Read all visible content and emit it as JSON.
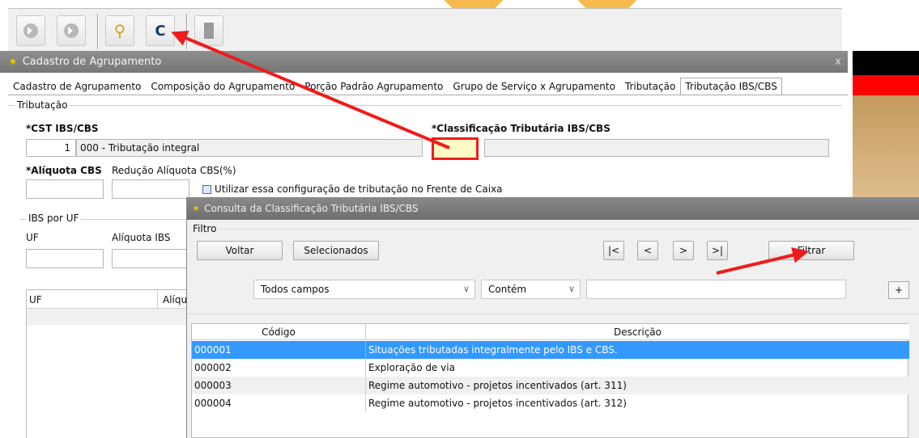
{
  "colors": {
    "accent_red": "#ee1c1c",
    "selection_blue": "#3399ff",
    "title_bar_grey": "#7f7f7f"
  },
  "toolbar": {
    "buttons": [
      {
        "name": "first-record-icon"
      },
      {
        "name": "next-record-icon"
      },
      {
        "name": "search-icon"
      },
      {
        "name": "consulta-c-icon",
        "label": "C"
      },
      {
        "name": "disabled-bar-icon"
      }
    ]
  },
  "main_window": {
    "title": "Cadastro de Agrupamento",
    "close": "x",
    "tabs": [
      {
        "label": "Cadastro de Agrupamento"
      },
      {
        "label": "Composição do Agrupamento"
      },
      {
        "label": "Porção Padrão Agrupamento"
      },
      {
        "label": "Grupo de Serviço x Agrupamento"
      },
      {
        "label": "Tributação"
      },
      {
        "label": "Tributação IBS/CBS"
      }
    ],
    "group_title": "Tributação",
    "cst_label": "*CST IBS/CBS",
    "cst_code": "1",
    "cst_desc": "000 - Tributação integral",
    "class_label": "*Classificação Tributária IBS/CBS",
    "aliq_cbs_label": "*Alíquota CBS",
    "red_aliq_label": "Redução Alíquota CBS(%)",
    "checkbox_label": "Utilizar essa configuração de tributação no Frente de Caixa",
    "ibs_uf_group": "IBS por UF",
    "uf_label": "UF",
    "aliq_ibs_label": "Alíquota IBS",
    "grid_col_uf": "UF",
    "grid_col_aliq": "Alíquo"
  },
  "dialog": {
    "title": "Consulta da Classificação Tributária IBS/CBS",
    "filter_group": "Filtro",
    "btn_voltar": "Voltar",
    "btn_selecionados": "Selecionados",
    "nav_first": "|<",
    "nav_prev": "<",
    "nav_next": ">",
    "nav_last": ">|",
    "btn_filtrar": "Filtrar",
    "field_select": "Todos campos",
    "op_select": "Contém",
    "search_value": "",
    "plus": "+",
    "grid": {
      "headers": [
        "Código",
        "Descrição"
      ],
      "rows": [
        {
          "codigo": "000001",
          "descricao": "Situações tributadas integralmente pelo IBS e CBS.",
          "selected": true
        },
        {
          "codigo": "000002",
          "descricao": "Exploração de via",
          "selected": false
        },
        {
          "codigo": "000003",
          "descricao": "Regime automotivo - projetos incentivados (art. 311)",
          "selected": false
        },
        {
          "codigo": "000004",
          "descricao": "Regime automotivo - projetos incentivados (art. 312)",
          "selected": false
        }
      ]
    }
  }
}
